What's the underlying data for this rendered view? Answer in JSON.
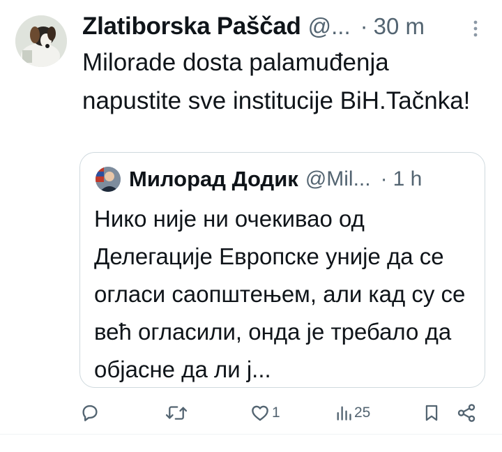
{
  "tweet": {
    "display_name": "Zlatiborska Paščad",
    "handle": "@...",
    "separator": "·",
    "time": "30 m",
    "text": "Milorade dosta palamuđenja napustite sve institucije BiH.Tačnka!",
    "avatar_icon": "dog-avatar"
  },
  "quote": {
    "display_name": "Милорад Додик",
    "handle": "@Mil...",
    "separator": "·",
    "time": "1 h",
    "text": "Нико није ни очекивао од Делегације Европске уније да се огласи саопштењем, али кад су се већ огласили, онда је требало да објасне да ли ј...",
    "avatar_icon": "person-avatar"
  },
  "actions": {
    "reply_count": "",
    "retweet_count": "",
    "like_count": "1",
    "views_count": "25"
  },
  "colors": {
    "text_primary": "#0f1419",
    "text_secondary": "#536471",
    "border": "#cfd9de"
  }
}
